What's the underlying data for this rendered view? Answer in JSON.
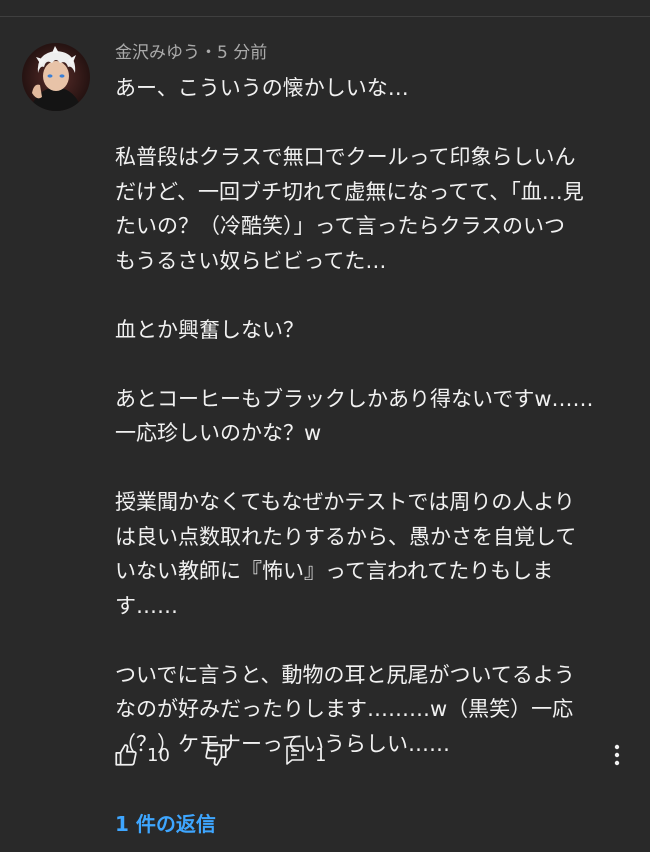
{
  "comment": {
    "author": "金沢みゆう",
    "separator": "・",
    "timestamp": "5 分前",
    "lines": [
      "あー、こういうの懐かしいな…",
      "",
      "私普段はクラスで無口でクールって印象らしいん",
      "だけど、一回ブチ切れて虚無になってて、「血…見",
      "たいの？（冷酷笑）」って言ったらクラスのいつ",
      "もうるさい奴らビビってた…",
      "",
      "血とか興奮しない？",
      "",
      "あとコーヒーもブラックしかあり得ないですw……",
      "一応珍しいのかな？w",
      "",
      "授業聞かなくてもなぜかテストでは周りの人より",
      "は良い点数取れたりするから、愚かさを自覚して",
      "いない教師に『怖い』って言われてたりもしま",
      "す……",
      "",
      "ついでに言うと、動物の耳と尻尾がついてるよう",
      "なのが好みだったりします………w（黒笑）一応",
      "（？）ケモナーっていうらしい……"
    ]
  },
  "actions": {
    "like_count": "10",
    "reply_count": "1"
  },
  "replies_link": "1 件の返信",
  "icons": {
    "like": "thumbs-up-icon",
    "dislike": "thumbs-down-icon",
    "reply": "comment-icon",
    "more": "more-vert-icon"
  },
  "colors": {
    "background": "#292929",
    "text": "#f1f1f1",
    "secondary_text": "#aaaaaa",
    "link": "#3ea6ff"
  }
}
